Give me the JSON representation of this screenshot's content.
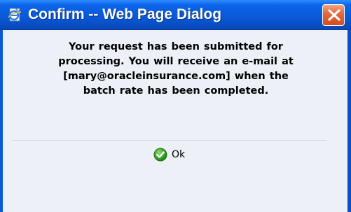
{
  "window": {
    "title": "Confirm -- Web Page Dialog",
    "title_icon": "ie-page-icon",
    "close_icon": "close-x-icon",
    "accent_color": "#0a5ad8",
    "close_color": "#e15f33"
  },
  "message": {
    "line1": "Your request has been submitted for",
    "line2": "processing. You will receive an e-mail at",
    "line3": "[mary@oracleinsurance.com] when the",
    "line4": "batch rate has been completed."
  },
  "actions": {
    "ok_label": "Ok",
    "ok_icon": "check-circle-icon"
  }
}
